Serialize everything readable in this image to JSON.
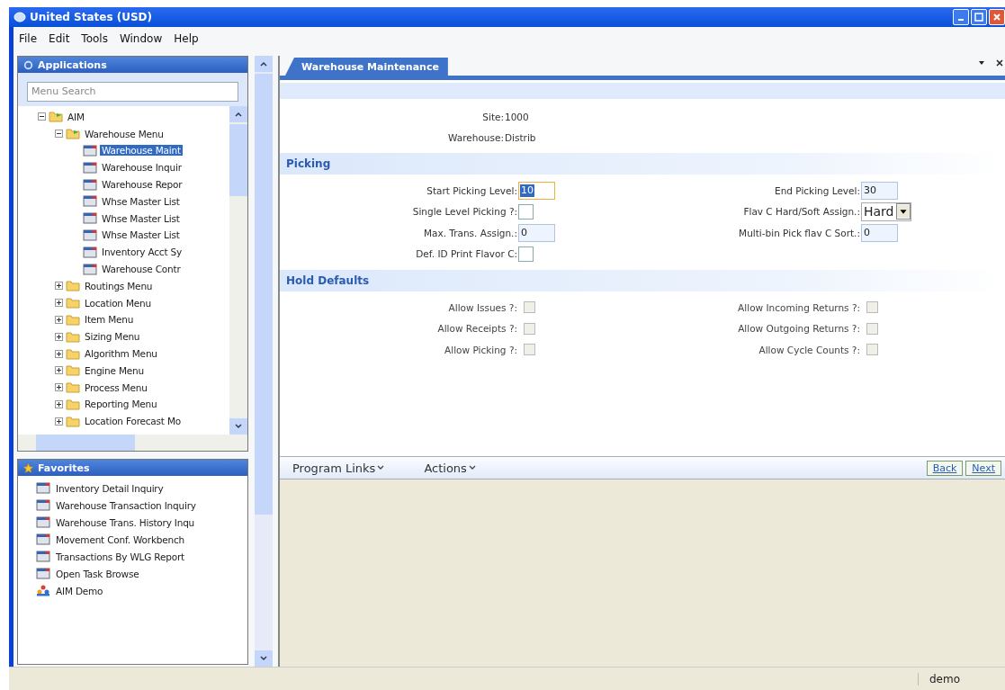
{
  "window": {
    "title": "United States (USD)"
  },
  "menu": [
    "File",
    "Edit",
    "Tools",
    "Window",
    "Help"
  ],
  "applications": {
    "title": "Applications",
    "search": {
      "placeholder": "Menu Search"
    },
    "tree": [
      {
        "label": "AIM",
        "kind": "folder",
        "expanded": true,
        "selected": false,
        "children": [
          {
            "label": "Warehouse Menu",
            "kind": "folder",
            "expanded": true,
            "selected": false,
            "children": [
              {
                "label": "Warehouse Maint",
                "kind": "program",
                "selected": true
              },
              {
                "label": "Warehouse Inquir",
                "kind": "program",
                "selected": false
              },
              {
                "label": "Warehouse Repor",
                "kind": "program",
                "selected": false
              },
              {
                "label": "Whse Master List",
                "kind": "program",
                "selected": false
              },
              {
                "label": "Whse Master List",
                "kind": "program",
                "selected": false
              },
              {
                "label": "Whse Master List",
                "kind": "program",
                "selected": false
              },
              {
                "label": "Inventory Acct Sy",
                "kind": "program",
                "selected": false
              },
              {
                "label": "Warehouse Contr",
                "kind": "program",
                "selected": false
              }
            ]
          },
          {
            "label": "Routings Menu",
            "kind": "folder",
            "expanded": false,
            "selected": false
          },
          {
            "label": "Location Menu",
            "kind": "folder",
            "expanded": false,
            "selected": false
          },
          {
            "label": "Item Menu",
            "kind": "folder",
            "expanded": false,
            "selected": false
          },
          {
            "label": "Sizing Menu",
            "kind": "folder",
            "expanded": false,
            "selected": false
          },
          {
            "label": "Algorithm Menu",
            "kind": "folder",
            "expanded": false,
            "selected": false
          },
          {
            "label": "Engine Menu",
            "kind": "folder",
            "expanded": false,
            "selected": false
          },
          {
            "label": "Process Menu",
            "kind": "folder",
            "expanded": false,
            "selected": false
          },
          {
            "label": "Reporting Menu",
            "kind": "folder",
            "expanded": false,
            "selected": false
          },
          {
            "label": "Location Forecast Mo",
            "kind": "folder",
            "expanded": false,
            "selected": false
          }
        ]
      }
    ]
  },
  "favorites": {
    "title": "Favorites",
    "items": [
      {
        "label": "Inventory Detail Inquiry",
        "kind": "program"
      },
      {
        "label": "Warehouse Transaction Inquiry",
        "kind": "program"
      },
      {
        "label": "Warehouse Trans. History Inqu",
        "kind": "program"
      },
      {
        "label": "Movement Conf. Workbench",
        "kind": "program"
      },
      {
        "label": "Transactions By WLG Report",
        "kind": "program"
      },
      {
        "label": "Open Task Browse",
        "kind": "program"
      },
      {
        "label": "AIM Demo",
        "kind": "demo"
      }
    ]
  },
  "tab": {
    "label": "Warehouse Maintenance",
    "selected": true
  },
  "header_fields": [
    {
      "label": "Site:",
      "value": "1000"
    },
    {
      "label": "Warehouse:",
      "value": "Distrib"
    }
  ],
  "sections": [
    {
      "title": "Picking",
      "left": [
        {
          "kind": "text",
          "label": "Start Picking Level:",
          "value": "10",
          "focused": true
        },
        {
          "kind": "checkbox",
          "label": "Single Level Picking ?:",
          "checked": false,
          "disabled": false
        },
        {
          "kind": "text",
          "label": "Max. Trans. Assign.:",
          "value": "0",
          "focused": false
        },
        {
          "kind": "checkbox",
          "label": "Def. ID Print Flavor C:",
          "checked": false,
          "disabled": false
        }
      ],
      "right": [
        {
          "kind": "text",
          "label": "End Picking Level:",
          "value": "30",
          "focused": false
        },
        {
          "kind": "select",
          "label": "Flav C Hard/Soft Assign.:",
          "value": "Hard"
        },
        {
          "kind": "text",
          "label": "Multi-bin Pick flav C Sort.:",
          "value": "0",
          "focused": false
        }
      ]
    },
    {
      "title": "Hold Defaults",
      "left": [
        {
          "kind": "checkbox",
          "label": "Allow Issues ?:",
          "checked": false,
          "disabled": true
        },
        {
          "kind": "checkbox",
          "label": "Allow Receipts ?:",
          "checked": false,
          "disabled": true
        },
        {
          "kind": "checkbox",
          "label": "Allow Picking ?:",
          "checked": false,
          "disabled": true
        }
      ],
      "right": [
        {
          "kind": "checkbox",
          "label": "Allow Incoming Returns ?:",
          "checked": false,
          "disabled": true
        },
        {
          "kind": "checkbox",
          "label": "Allow Outgoing Returns ?:",
          "checked": false,
          "disabled": true
        },
        {
          "kind": "checkbox",
          "label": "Allow Cycle Counts ?:",
          "checked": false,
          "disabled": true
        }
      ]
    }
  ],
  "footer": {
    "menus": [
      "Program Links",
      "Actions"
    ],
    "buttons": [
      "Back",
      "Next"
    ]
  },
  "status_bar": {
    "user": "demo"
  }
}
